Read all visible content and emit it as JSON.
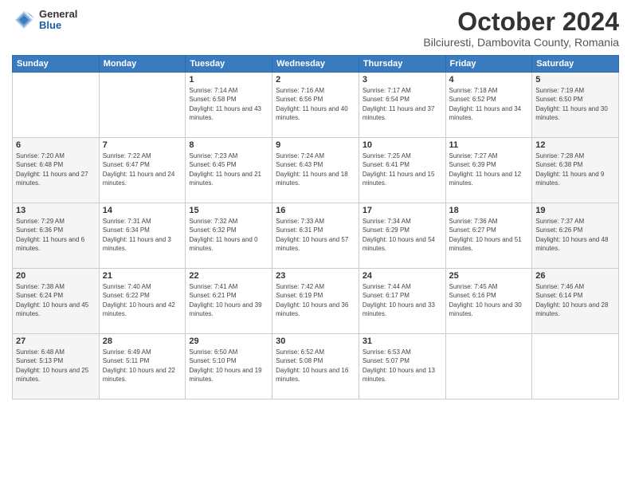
{
  "header": {
    "logo": {
      "general": "General",
      "blue": "Blue"
    },
    "title": "October 2024",
    "location": "Bilciuresti, Dambovita County, Romania"
  },
  "days_of_week": [
    "Sunday",
    "Monday",
    "Tuesday",
    "Wednesday",
    "Thursday",
    "Friday",
    "Saturday"
  ],
  "weeks": [
    [
      {
        "day": "",
        "info": ""
      },
      {
        "day": "",
        "info": ""
      },
      {
        "day": "1",
        "info": "Sunrise: 7:14 AM\nSunset: 6:58 PM\nDaylight: 11 hours and 43 minutes."
      },
      {
        "day": "2",
        "info": "Sunrise: 7:16 AM\nSunset: 6:56 PM\nDaylight: 11 hours and 40 minutes."
      },
      {
        "day": "3",
        "info": "Sunrise: 7:17 AM\nSunset: 6:54 PM\nDaylight: 11 hours and 37 minutes."
      },
      {
        "day": "4",
        "info": "Sunrise: 7:18 AM\nSunset: 6:52 PM\nDaylight: 11 hours and 34 minutes."
      },
      {
        "day": "5",
        "info": "Sunrise: 7:19 AM\nSunset: 6:50 PM\nDaylight: 11 hours and 30 minutes."
      }
    ],
    [
      {
        "day": "6",
        "info": "Sunrise: 7:20 AM\nSunset: 6:48 PM\nDaylight: 11 hours and 27 minutes."
      },
      {
        "day": "7",
        "info": "Sunrise: 7:22 AM\nSunset: 6:47 PM\nDaylight: 11 hours and 24 minutes."
      },
      {
        "day": "8",
        "info": "Sunrise: 7:23 AM\nSunset: 6:45 PM\nDaylight: 11 hours and 21 minutes."
      },
      {
        "day": "9",
        "info": "Sunrise: 7:24 AM\nSunset: 6:43 PM\nDaylight: 11 hours and 18 minutes."
      },
      {
        "day": "10",
        "info": "Sunrise: 7:25 AM\nSunset: 6:41 PM\nDaylight: 11 hours and 15 minutes."
      },
      {
        "day": "11",
        "info": "Sunrise: 7:27 AM\nSunset: 6:39 PM\nDaylight: 11 hours and 12 minutes."
      },
      {
        "day": "12",
        "info": "Sunrise: 7:28 AM\nSunset: 6:38 PM\nDaylight: 11 hours and 9 minutes."
      }
    ],
    [
      {
        "day": "13",
        "info": "Sunrise: 7:29 AM\nSunset: 6:36 PM\nDaylight: 11 hours and 6 minutes."
      },
      {
        "day": "14",
        "info": "Sunrise: 7:31 AM\nSunset: 6:34 PM\nDaylight: 11 hours and 3 minutes."
      },
      {
        "day": "15",
        "info": "Sunrise: 7:32 AM\nSunset: 6:32 PM\nDaylight: 11 hours and 0 minutes."
      },
      {
        "day": "16",
        "info": "Sunrise: 7:33 AM\nSunset: 6:31 PM\nDaylight: 10 hours and 57 minutes."
      },
      {
        "day": "17",
        "info": "Sunrise: 7:34 AM\nSunset: 6:29 PM\nDaylight: 10 hours and 54 minutes."
      },
      {
        "day": "18",
        "info": "Sunrise: 7:36 AM\nSunset: 6:27 PM\nDaylight: 10 hours and 51 minutes."
      },
      {
        "day": "19",
        "info": "Sunrise: 7:37 AM\nSunset: 6:26 PM\nDaylight: 10 hours and 48 minutes."
      }
    ],
    [
      {
        "day": "20",
        "info": "Sunrise: 7:38 AM\nSunset: 6:24 PM\nDaylight: 10 hours and 45 minutes."
      },
      {
        "day": "21",
        "info": "Sunrise: 7:40 AM\nSunset: 6:22 PM\nDaylight: 10 hours and 42 minutes."
      },
      {
        "day": "22",
        "info": "Sunrise: 7:41 AM\nSunset: 6:21 PM\nDaylight: 10 hours and 39 minutes."
      },
      {
        "day": "23",
        "info": "Sunrise: 7:42 AM\nSunset: 6:19 PM\nDaylight: 10 hours and 36 minutes."
      },
      {
        "day": "24",
        "info": "Sunrise: 7:44 AM\nSunset: 6:17 PM\nDaylight: 10 hours and 33 minutes."
      },
      {
        "day": "25",
        "info": "Sunrise: 7:45 AM\nSunset: 6:16 PM\nDaylight: 10 hours and 30 minutes."
      },
      {
        "day": "26",
        "info": "Sunrise: 7:46 AM\nSunset: 6:14 PM\nDaylight: 10 hours and 28 minutes."
      }
    ],
    [
      {
        "day": "27",
        "info": "Sunrise: 6:48 AM\nSunset: 5:13 PM\nDaylight: 10 hours and 25 minutes."
      },
      {
        "day": "28",
        "info": "Sunrise: 6:49 AM\nSunset: 5:11 PM\nDaylight: 10 hours and 22 minutes."
      },
      {
        "day": "29",
        "info": "Sunrise: 6:50 AM\nSunset: 5:10 PM\nDaylight: 10 hours and 19 minutes."
      },
      {
        "day": "30",
        "info": "Sunrise: 6:52 AM\nSunset: 5:08 PM\nDaylight: 10 hours and 16 minutes."
      },
      {
        "day": "31",
        "info": "Sunrise: 6:53 AM\nSunset: 5:07 PM\nDaylight: 10 hours and 13 minutes."
      },
      {
        "day": "",
        "info": ""
      },
      {
        "day": "",
        "info": ""
      }
    ]
  ]
}
